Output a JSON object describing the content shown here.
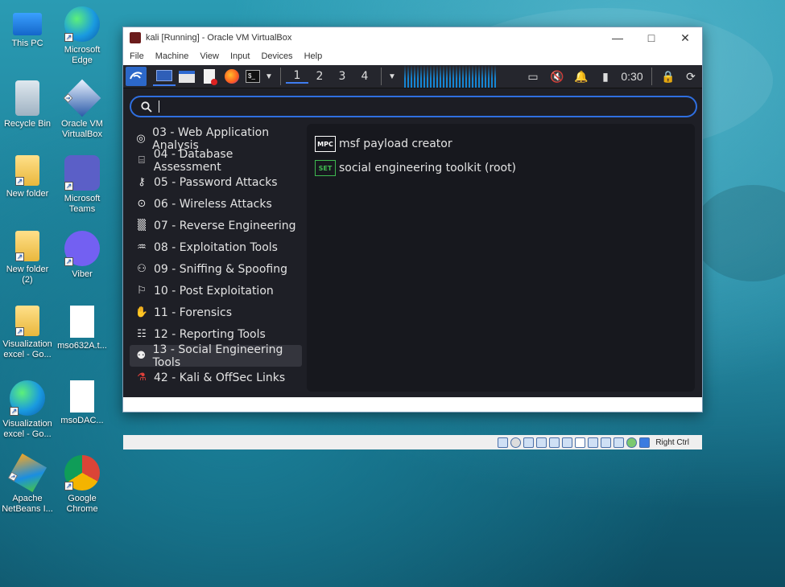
{
  "desktop": {
    "icons": [
      {
        "label": "This PC",
        "icon": "pc-icon"
      },
      {
        "label": "Microsoft Edge",
        "icon": "edge-icon"
      },
      {
        "label": "Recycle Bin",
        "icon": "recycle-bin-icon"
      },
      {
        "label": "Oracle VM VirtualBox",
        "icon": "virtualbox-icon"
      },
      {
        "label": "New folder",
        "icon": "folder-icon"
      },
      {
        "label": "Microsoft Teams",
        "icon": "teams-icon"
      },
      {
        "label": "New folder (2)",
        "icon": "folder-icon"
      },
      {
        "label": "Viber",
        "icon": "viber-icon"
      },
      {
        "label": "Visualization excel - Go...",
        "icon": "folder-icon"
      },
      {
        "label": "mso632A.t...",
        "icon": "file-icon"
      },
      {
        "label": "Visualization excel - Go...",
        "icon": "edge-icon"
      },
      {
        "label": "msoDAC...",
        "icon": "file-icon"
      },
      {
        "label": "Apache NetBeans I...",
        "icon": "netbeans-icon"
      },
      {
        "label": "Google Chrome",
        "icon": "chrome-icon"
      }
    ]
  },
  "window": {
    "title": "kali [Running] - Oracle VM VirtualBox",
    "menu": [
      "File",
      "Machine",
      "View",
      "Input",
      "Devices",
      "Help"
    ],
    "minimize": "—",
    "maximize": "□",
    "close": "✕"
  },
  "panel": {
    "workspaces": [
      "1",
      "2",
      "3",
      "4"
    ],
    "active_workspace": "1",
    "clock": "0:30"
  },
  "search": {
    "placeholder": "",
    "value": ""
  },
  "categories": [
    {
      "label": "03 - Web Application Analysis",
      "icon": "globe-icon",
      "glyph": "◎"
    },
    {
      "label": "04 - Database Assessment",
      "icon": "database-icon",
      "glyph": "⌸"
    },
    {
      "label": "05 - Password Attacks",
      "icon": "key-icon",
      "glyph": "⚷"
    },
    {
      "label": "06 - Wireless Attacks",
      "icon": "wireless-icon",
      "glyph": "⊙"
    },
    {
      "label": "07 - Reverse Engineering",
      "icon": "reverse-icon",
      "glyph": "▒"
    },
    {
      "label": "08 - Exploitation Tools",
      "icon": "exploit-icon",
      "glyph": "♒"
    },
    {
      "label": "09 - Sniffing & Spoofing",
      "icon": "sniff-icon",
      "glyph": "⚇"
    },
    {
      "label": "10 - Post Exploitation",
      "icon": "post-exploit-icon",
      "glyph": "⚐"
    },
    {
      "label": "11 - Forensics",
      "icon": "hand-icon",
      "glyph": "✋"
    },
    {
      "label": "12 - Reporting Tools",
      "icon": "report-icon",
      "glyph": "☷"
    },
    {
      "label": "13 - Social Engineering Tools",
      "icon": "social-icon",
      "glyph": "⚉"
    },
    {
      "label": "42 - Kali & OffSec Links",
      "icon": "kali-link-icon",
      "glyph": "⚗"
    }
  ],
  "selected_category": "13 - Social Engineering Tools",
  "apps": [
    {
      "label": "msf payload creator",
      "icon": "mpc-icon",
      "badge": "MPC",
      "color": "#ffffff"
    },
    {
      "label": "social engineering toolkit (root)",
      "icon": "set-icon",
      "badge": "SET",
      "color": "#3fb950"
    }
  ],
  "statusbar": {
    "host_key": "Right Ctrl"
  },
  "colors": {
    "accent": "#2f6fe0",
    "guest_bg": "#1e1f26",
    "panel_bg": "#25262d"
  }
}
